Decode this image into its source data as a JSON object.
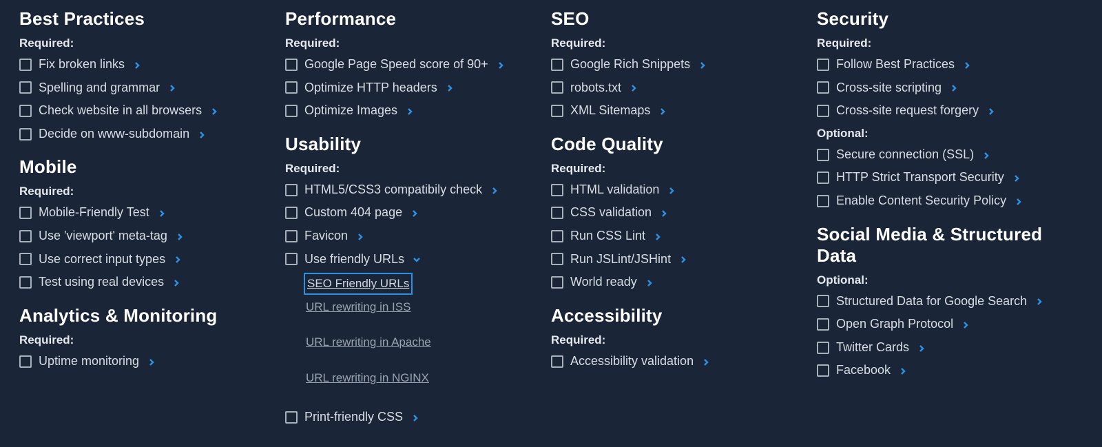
{
  "labels": {
    "required": "Required:",
    "optional": "Optional:"
  },
  "columns": [
    {
      "sections": [
        {
          "title": "Best Practices",
          "groups": [
            {
              "label_key": "required",
              "items": [
                {
                  "label": "Fix broken links",
                  "arrow": "right"
                },
                {
                  "label": "Spelling and grammar",
                  "arrow": "right"
                },
                {
                  "label": "Check website in all browsers",
                  "arrow": "right"
                },
                {
                  "label": "Decide on www-subdomain",
                  "arrow": "right"
                }
              ]
            }
          ]
        },
        {
          "title": "Mobile",
          "groups": [
            {
              "label_key": "required",
              "items": [
                {
                  "label": "Mobile-Friendly Test",
                  "arrow": "right"
                },
                {
                  "label": "Use 'viewport' meta-tag",
                  "arrow": "right"
                },
                {
                  "label": "Use correct input types",
                  "arrow": "right"
                },
                {
                  "label": "Test using real devices",
                  "arrow": "right"
                }
              ]
            }
          ]
        },
        {
          "title": "Analytics & Monitoring",
          "groups": [
            {
              "label_key": "required",
              "items": [
                {
                  "label": "Uptime monitoring",
                  "arrow": "right"
                }
              ]
            }
          ]
        }
      ]
    },
    {
      "sections": [
        {
          "title": "Performance",
          "groups": [
            {
              "label_key": "required",
              "items": [
                {
                  "label": "Google Page Speed score of 90+",
                  "arrow": "right"
                },
                {
                  "label": "Optimize HTTP headers",
                  "arrow": "right"
                },
                {
                  "label": "Optimize Images",
                  "arrow": "right"
                }
              ]
            }
          ]
        },
        {
          "title": "Usability",
          "groups": [
            {
              "label_key": "required",
              "items": [
                {
                  "label": "HTML5/CSS3 compatibily check",
                  "arrow": "right"
                },
                {
                  "label": "Custom 404 page",
                  "arrow": "right"
                },
                {
                  "label": "Favicon",
                  "arrow": "right"
                },
                {
                  "label": "Use friendly URLs",
                  "arrow": "down",
                  "sublinks": [
                    {
                      "label": "SEO Friendly URLs",
                      "focused": true
                    },
                    {
                      "label": "URL rewriting in ISS"
                    },
                    {
                      "label": "URL rewriting in Apache"
                    },
                    {
                      "label": "URL rewriting in NGINX"
                    }
                  ]
                },
                {
                  "label": "Print-friendly CSS",
                  "arrow": "right"
                }
              ]
            }
          ]
        }
      ]
    },
    {
      "sections": [
        {
          "title": "SEO",
          "groups": [
            {
              "label_key": "required",
              "items": [
                {
                  "label": "Google Rich Snippets",
                  "arrow": "right"
                },
                {
                  "label": "robots.txt",
                  "arrow": "right"
                },
                {
                  "label": "XML Sitemaps",
                  "arrow": "right"
                }
              ]
            }
          ]
        },
        {
          "title": "Code Quality",
          "groups": [
            {
              "label_key": "required",
              "items": [
                {
                  "label": "HTML validation",
                  "arrow": "right"
                },
                {
                  "label": "CSS validation",
                  "arrow": "right"
                },
                {
                  "label": "Run CSS Lint",
                  "arrow": "right"
                },
                {
                  "label": "Run JSLint/JSHint",
                  "arrow": "right"
                },
                {
                  "label": "World ready",
                  "arrow": "right"
                }
              ]
            }
          ]
        },
        {
          "title": "Accessibility",
          "groups": [
            {
              "label_key": "required",
              "items": [
                {
                  "label": "Accessibility validation",
                  "arrow": "right"
                }
              ]
            }
          ]
        }
      ]
    },
    {
      "sections": [
        {
          "title": "Security",
          "groups": [
            {
              "label_key": "required",
              "items": [
                {
                  "label": "Follow Best Practices",
                  "arrow": "right"
                },
                {
                  "label": "Cross-site scripting",
                  "arrow": "right"
                },
                {
                  "label": "Cross-site request forgery",
                  "arrow": "right"
                }
              ]
            },
            {
              "label_key": "optional",
              "items": [
                {
                  "label": "Secure connection (SSL)",
                  "arrow": "right"
                },
                {
                  "label": "HTTP Strict Transport Security",
                  "arrow": "right"
                },
                {
                  "label": "Enable Content Security Policy",
                  "arrow": "right"
                }
              ]
            }
          ]
        },
        {
          "title": "Social Media & Structured Data",
          "groups": [
            {
              "label_key": "optional",
              "items": [
                {
                  "label": "Structured Data for Google Search",
                  "arrow": "right"
                },
                {
                  "label": "Open Graph Protocol",
                  "arrow": "right"
                },
                {
                  "label": "Twitter Cards",
                  "arrow": "right"
                },
                {
                  "label": "Facebook",
                  "arrow": "right"
                }
              ]
            }
          ]
        }
      ]
    }
  ]
}
